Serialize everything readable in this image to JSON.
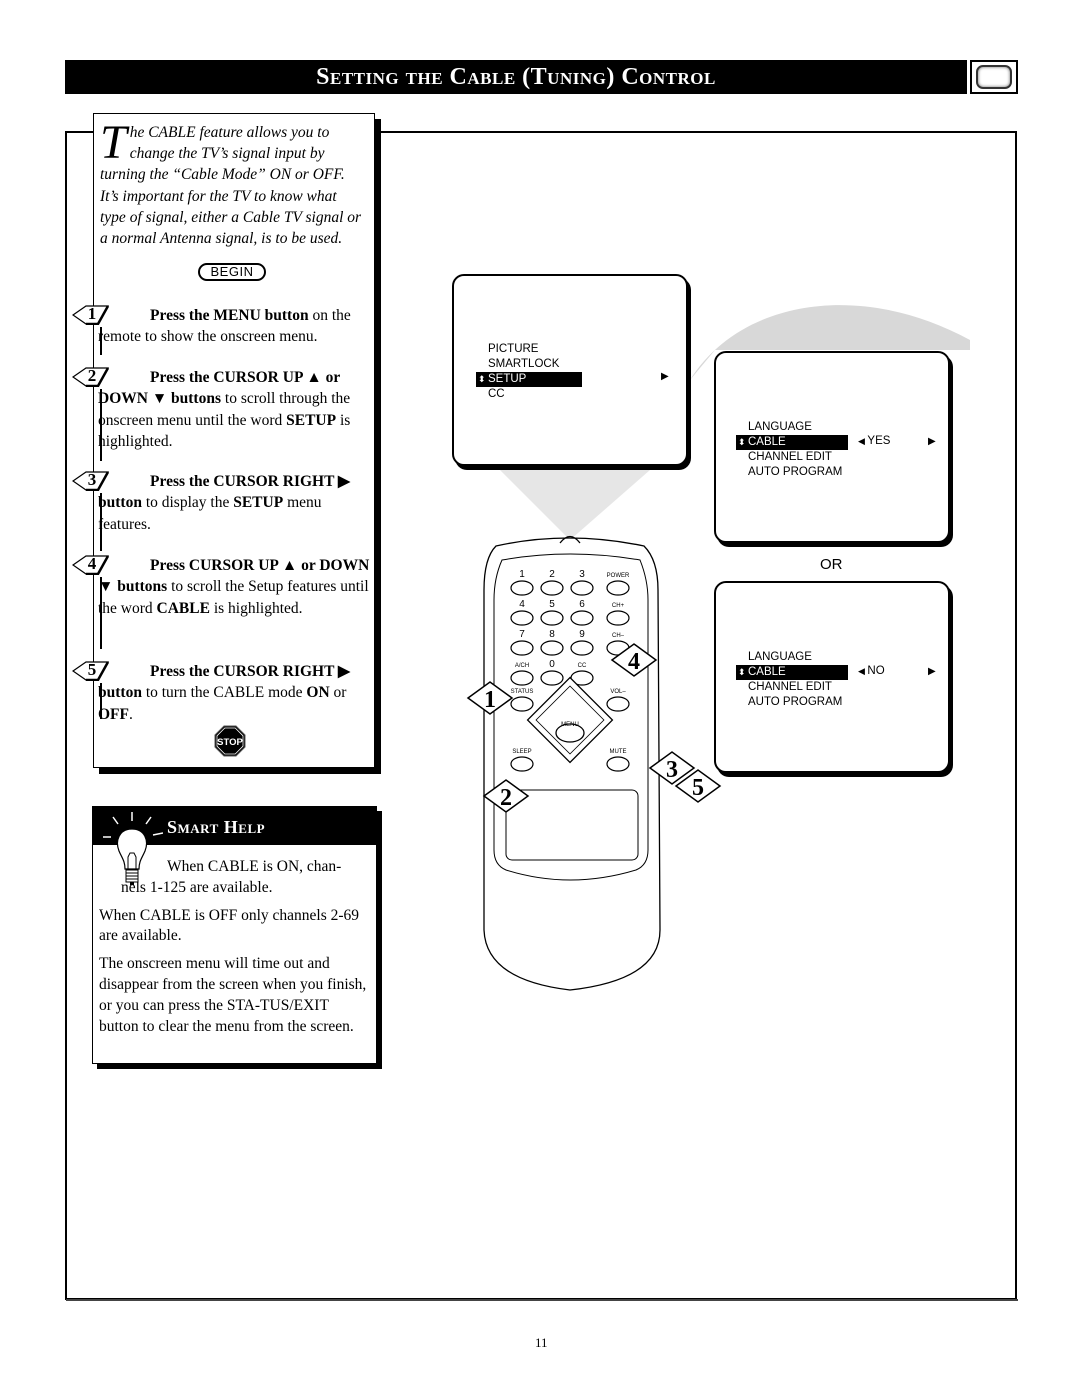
{
  "header": {
    "title": "Setting the Cable (Tuning) Control",
    "icon": "tv-screen-icon"
  },
  "intro": {
    "dropcap": "T",
    "text": "he CABLE feature allows you to change the TV’s signal input by turning the “Cable Mode” ON or OFF. It’s important for the TV to know what type of signal, either a Cable TV signal or a normal Antenna signal, is to be used.",
    "begin_label": "BEGIN"
  },
  "steps": [
    {
      "number": "1",
      "head": "Press the MENU button",
      "body": " on the remote to show the onscreen menu."
    },
    {
      "number": "2",
      "head": "Press the CURSOR UP ▲ or DOWN ▼ buttons",
      "body": " to scroll through the onscreen menu until the word ",
      "bold_tail": "SETUP",
      "tail": " is highlighted."
    },
    {
      "number": "3",
      "head": "Press the CURSOR RIGHT ▶ button",
      "body": " to display the ",
      "bold_tail": "SETUP",
      "tail": " menu features."
    },
    {
      "number": "4",
      "head": "Press CURSOR UP ▲ or DOWN ▼ buttons",
      "body": " to scroll the Setup features until the word ",
      "bold_tail": "CABLE",
      "tail": " is highlighted."
    },
    {
      "number": "5",
      "head": "Press the CURSOR RIGHT ▶ button",
      "body": " to turn the CABLE mode ",
      "bold_tail": "ON",
      "tail": " or ",
      "bold_tail2": "OFF",
      "tail2": "."
    }
  ],
  "stop_label": "STOP",
  "smart_help": {
    "title": "Smart Help",
    "p1a": "When CABLE is ON, chan-",
    "p1b": "nels 1-125 are available.",
    "p2": "When CABLE is OFF only channels 2-69 are available.",
    "p3": "The onscreen menu will time out and disappear from the screen when you finish, or you can press the STA-TUS/EXIT button to clear the menu from the screen."
  },
  "screens": {
    "main_menu": {
      "items": [
        "PICTURE",
        "SMARTLOCK",
        "SETUP",
        "CC"
      ],
      "selected": "SETUP"
    },
    "setup_yes": {
      "items": [
        "LANGUAGE",
        "CABLE",
        "CHANNEL EDIT",
        "AUTO PROGRAM"
      ],
      "selected": "CABLE",
      "value": "YES"
    },
    "or_label": "OR",
    "setup_no": {
      "items": [
        "LANGUAGE",
        "CABLE",
        "CHANNEL EDIT",
        "AUTO PROGRAM"
      ],
      "selected": "CABLE",
      "value": "NO"
    }
  },
  "remote": {
    "keys": [
      "1",
      "2",
      "3",
      "POWER",
      "4",
      "5",
      "6",
      "CH+",
      "7",
      "8",
      "9",
      "CH–",
      "A/CH",
      "0",
      "CC",
      "STATUS",
      "VOL–",
      "MENU",
      "SLEEP",
      "MUTE"
    ],
    "callouts": [
      "1",
      "2",
      "3",
      "4",
      "5"
    ]
  },
  "page_number": "11"
}
